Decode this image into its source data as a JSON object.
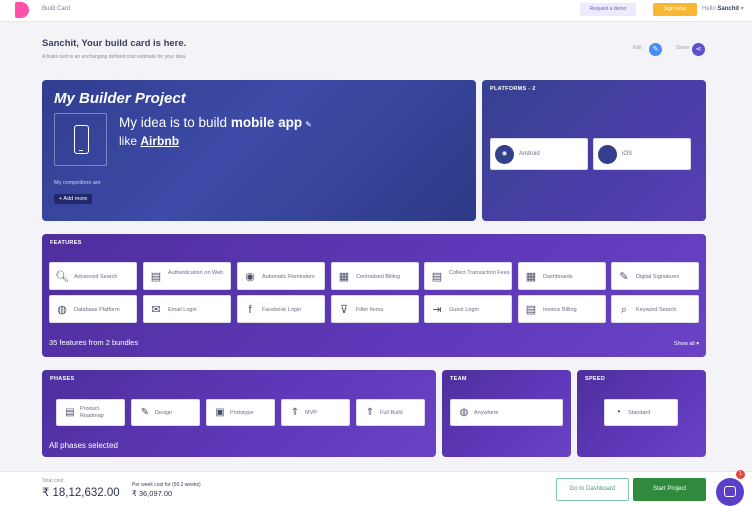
{
  "header": {
    "brand": "Build Card",
    "request_demo": "Request a demo",
    "sign_in": "Sign in/up",
    "greeting_prefix": "Hello",
    "user": "Sanchit",
    "colors": {
      "logo": "#ff4fa8",
      "sign_in_bg": "#f7b733"
    }
  },
  "page": {
    "title": "Sanchit, Your build card is here.",
    "subtitle": "A build card is an unchanging defined cost estimate for your idea.",
    "edit_label": "Edit",
    "share_label": "Share"
  },
  "project": {
    "title": "My Builder Project",
    "idea_prefix": "My idea is to build",
    "idea_app": "mobile app",
    "like_prefix": "like",
    "like_app": "Airbnb",
    "competitors_label": "My competitors are",
    "add_more": "+ Add more",
    "icon": "phone-icon"
  },
  "platforms": {
    "label": "PLATFORMS - 2",
    "items": [
      {
        "label": "Android",
        "icon": "android-icon",
        "glyph": "◉"
      },
      {
        "label": "iOS",
        "icon": "ios-icon",
        "glyph": ""
      }
    ]
  },
  "features": {
    "label": "FEATURES",
    "items": [
      {
        "label": "Advanced Search",
        "icon": "search-icon",
        "glyph": "🔍︎"
      },
      {
        "label": "Authentication on Web",
        "icon": "auth-icon",
        "glyph": "▤"
      },
      {
        "label": "Automatic Reminders",
        "icon": "eye-icon",
        "glyph": "◉"
      },
      {
        "label": "Centralised Billing",
        "icon": "billing-icon",
        "glyph": "▦"
      },
      {
        "label": "Collect Transaction Fees",
        "icon": "fees-icon",
        "glyph": "▤"
      },
      {
        "label": "Dashboards",
        "icon": "dashboard-icon",
        "glyph": "▦"
      },
      {
        "label": "Digital Signatures",
        "icon": "signature-icon",
        "glyph": "✎"
      },
      {
        "label": "Database Platform",
        "icon": "database-icon",
        "glyph": "◍"
      },
      {
        "label": "Email Login",
        "icon": "email-icon",
        "glyph": "✉"
      },
      {
        "label": "Facebook Login",
        "icon": "facebook-icon",
        "glyph": "f"
      },
      {
        "label": "Filter Items",
        "icon": "filter-icon",
        "glyph": "⊽"
      },
      {
        "label": "Guest Login",
        "icon": "guest-icon",
        "glyph": "⇥"
      },
      {
        "label": "Invoice Billing",
        "icon": "invoice-icon",
        "glyph": "▤"
      },
      {
        "label": "Keyword Search",
        "icon": "keyword-icon",
        "glyph": "⌕"
      }
    ],
    "count_text": "35 features from 2 bundles",
    "show_all": "Show all ▾"
  },
  "phases": {
    "label": "PHASES",
    "items": [
      {
        "label": "Product Roadmap",
        "icon": "roadmap-icon",
        "glyph": "▤"
      },
      {
        "label": "Design",
        "icon": "design-icon",
        "glyph": "✎"
      },
      {
        "label": "Prototype",
        "icon": "prototype-icon",
        "glyph": "▣"
      },
      {
        "label": "MVP",
        "icon": "rocket-icon",
        "glyph": "⇑"
      },
      {
        "label": "Full Build",
        "icon": "full-build-icon",
        "glyph": "⇑"
      }
    ],
    "status": "All phases selected"
  },
  "team": {
    "label": "TEAM",
    "value": "Anywhere",
    "icon": "globe-icon",
    "glyph": "◍"
  },
  "speed": {
    "label": "SPEED",
    "value": "Standard",
    "icon": "speedometer-icon",
    "glyph": "◔"
  },
  "footer": {
    "total_label": "Total cost",
    "total_value": "₹ 18,12,632.00",
    "week_label": "Per week cost for (50.2 weeks)",
    "week_value": "₹ 36,097.00",
    "dashboard": "Go to Dashboard",
    "start": "Start Project",
    "chat_badge": "1"
  }
}
